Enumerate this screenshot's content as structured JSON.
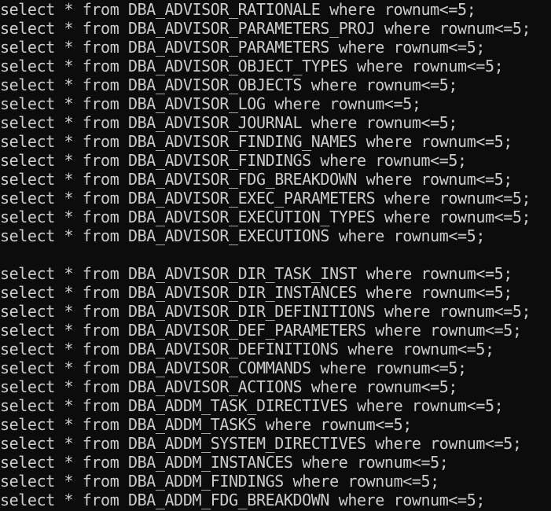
{
  "terminal": {
    "background": "#0c0c0c",
    "foreground": "#cccccc",
    "lines": [
      "select * from DBA_ADVISOR_RATIONALE where rownum<=5;",
      "select * from DBA_ADVISOR_PARAMETERS_PROJ where rownum<=5;",
      "select * from DBA_ADVISOR_PARAMETERS where rownum<=5;",
      "select * from DBA_ADVISOR_OBJECT_TYPES where rownum<=5;",
      "select * from DBA_ADVISOR_OBJECTS where rownum<=5;",
      "select * from DBA_ADVISOR_LOG where rownum<=5;",
      "select * from DBA_ADVISOR_JOURNAL where rownum<=5;",
      "select * from DBA_ADVISOR_FINDING_NAMES where rownum<=5;",
      "select * from DBA_ADVISOR_FINDINGS where rownum<=5;",
      "select * from DBA_ADVISOR_FDG_BREAKDOWN where rownum<=5;",
      "select * from DBA_ADVISOR_EXEC_PARAMETERS where rownum<=5;",
      "select * from DBA_ADVISOR_EXECUTION_TYPES where rownum<=5;",
      "select * from DBA_ADVISOR_EXECUTIONS where rownum<=5;",
      "",
      "select * from DBA_ADVISOR_DIR_TASK_INST where rownum<=5;",
      "select * from DBA_ADVISOR_DIR_INSTANCES where rownum<=5;",
      "select * from DBA_ADVISOR_DIR_DEFINITIONS where rownum<=5;",
      "select * from DBA_ADVISOR_DEF_PARAMETERS where rownum<=5;",
      "select * from DBA_ADVISOR_DEFINITIONS where rownum<=5;",
      "select * from DBA_ADVISOR_COMMANDS where rownum<=5;",
      "select * from DBA_ADVISOR_ACTIONS where rownum<=5;",
      "select * from DBA_ADDM_TASK_DIRECTIVES where rownum<=5;",
      "select * from DBA_ADDM_TASKS where rownum<=5;",
      "select * from DBA_ADDM_SYSTEM_DIRECTIVES where rownum<=5;",
      "select * from DBA_ADDM_INSTANCES where rownum<=5;",
      "select * from DBA_ADDM_FINDINGS where rownum<=5;",
      "select * from DBA_ADDM_FDG_BREAKDOWN where rownum<=5;"
    ]
  }
}
